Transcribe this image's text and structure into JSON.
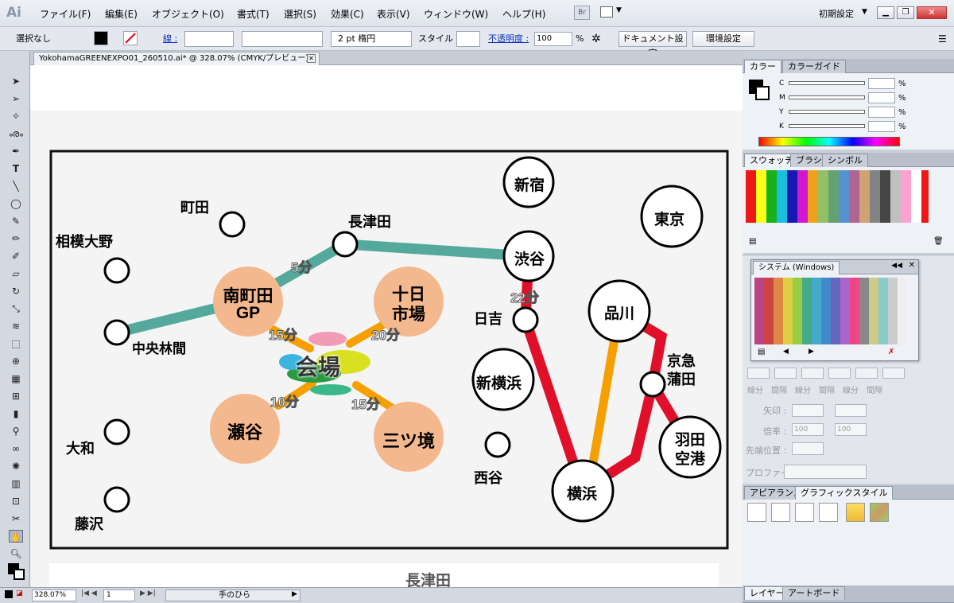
{
  "app": {
    "logo": "Ai"
  },
  "menu": [
    "ファイル(F)",
    "編集(E)",
    "オブジェクト(O)",
    "書式(T)",
    "選択(S)",
    "効果(C)",
    "表示(V)",
    "ウィンドウ(W)",
    "ヘルプ(H)"
  ],
  "menu_right": {
    "br": "Br",
    "workspace": "初期設定"
  },
  "control": {
    "selection": "選択なし",
    "stroke_label": "線 :",
    "stroke_weight": "2 pt 楕円",
    "style_label": "スタイル :",
    "opacity_label": "不透明度 :",
    "opacity_value": "100",
    "opacity_unit": "%",
    "doc_settings": "ドキュメント設定",
    "env_settings": "環境設定"
  },
  "document": {
    "tab_title": "YokohamaGREENEXPO01_260510.ai* @ 328.07% (CMYK/プレビュー)"
  },
  "status": {
    "zoom": "328.07%",
    "artboard": "1",
    "tool": "手のひら"
  },
  "panels": {
    "color_tabs": [
      "カラー",
      "カラーガイド"
    ],
    "cmyk": [
      "C",
      "M",
      "Y",
      "K"
    ],
    "pct": "%",
    "swatch_tabs": [
      "スウォッチ",
      "ブラシ",
      "シンボル"
    ],
    "system_panel_title": "システム (Windows)",
    "stroke_labels": [
      "線分",
      "間隔",
      "線分",
      "間隔",
      "線分",
      "間隔"
    ],
    "arrow_label": "矢印 :",
    "scale_label": "倍率 :",
    "scale_values": [
      "100",
      "100"
    ],
    "align_label": "先端位置 :",
    "profile_label": "プロファイル :",
    "appearance_tabs": [
      "アピアランス",
      "グラフィックスタイル"
    ],
    "layer_tabs": [
      "レイヤー",
      "アートボード"
    ]
  },
  "map": {
    "stations": {
      "machida": "町田",
      "sagamiono": "相模大野",
      "nagatsuta": "長津田",
      "chuorinkan": "中央林間",
      "yamato": "大和",
      "fujisawa": "藤沢",
      "shinjuku": "新宿",
      "tokyo": "東京",
      "shibuya": "渋谷",
      "hiyoshi": "日吉",
      "shinagawa": "品川",
      "shinyokohama": "新横浜",
      "keikyukamata_1": "京急",
      "keikyukamata_2": "蒲田",
      "nishiya": "西谷",
      "haneda_1": "羽田",
      "haneda_2": "空港",
      "yokohama": "横浜"
    },
    "hubs": {
      "minamimachida_1": "南町田",
      "minamimachida_2": "GP",
      "tokaichiba_1": "十日",
      "tokaichiba_2": "市場",
      "seya": "瀬谷",
      "mitsukyo": "三ツ境",
      "venue": "会場"
    },
    "times": {
      "nagatsuta_minamimachida": "5分",
      "shibuya_hiyoshi": "22分",
      "minamimachida_venue": "15分",
      "tokaichiba_venue": "20分",
      "seya_venue": "10分",
      "mitsukyo_venue": "15分"
    },
    "below_artboard": "長津田"
  },
  "colors": {
    "teal_line": "#55a99c",
    "red_line": "#e0102a",
    "orange_line": "#f5a000",
    "hub_fill": "#f4b88e"
  }
}
